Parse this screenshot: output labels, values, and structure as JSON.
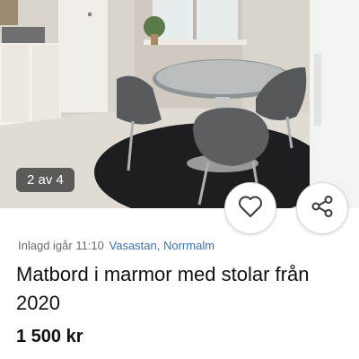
{
  "gallery": {
    "counter": "2 av 4"
  },
  "actions": {
    "favorite_icon": "heart-icon",
    "share_icon": "share-icon"
  },
  "listing": {
    "posted": "Inlagd igår 11:10",
    "location": "Vasastan, Norrmalm",
    "title": "Matbord i marmor med stolar från 2020",
    "price": "1 500 kr"
  },
  "colors": {
    "location_link": "#3a6fb0",
    "text": "#111111",
    "meta_text": "#6b6b6b"
  }
}
